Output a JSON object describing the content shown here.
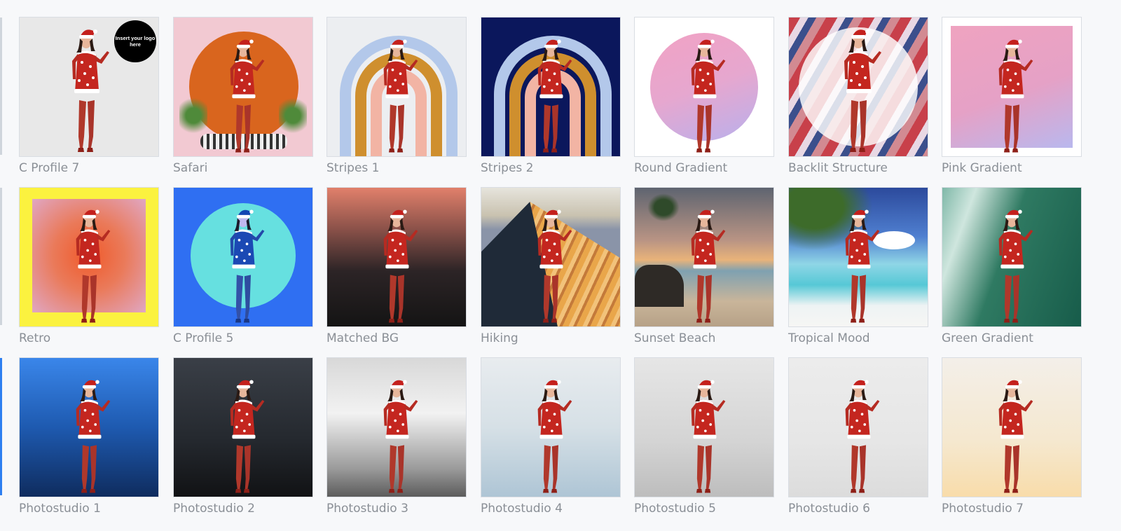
{
  "gallery": {
    "logo_badge_text": "Insert your logo here",
    "rows": [
      [
        {
          "label": "C Profile 7"
        },
        {
          "label": "Safari"
        },
        {
          "label": "Stripes 1"
        },
        {
          "label": "Stripes 2"
        },
        {
          "label": "Round Gradient"
        },
        {
          "label": "Backlit Structure"
        },
        {
          "label": "Pink Gradient"
        }
      ],
      [
        {
          "label": "Retro"
        },
        {
          "label": "C Profile 5"
        },
        {
          "label": "Matched BG"
        },
        {
          "label": "Hiking"
        },
        {
          "label": "Sunset Beach"
        },
        {
          "label": "Tropical Mood"
        },
        {
          "label": "Green Gradient"
        }
      ],
      [
        {
          "label": "Photostudio 1"
        },
        {
          "label": "Photostudio 2"
        },
        {
          "label": "Photostudio 3"
        },
        {
          "label": "Photostudio 4"
        },
        {
          "label": "Photostudio 5"
        },
        {
          "label": "Photostudio 6"
        },
        {
          "label": "Photostudio 7"
        }
      ]
    ]
  },
  "colors": {
    "label_text": "#8a8f96",
    "page_background": "#f7f8fa"
  }
}
